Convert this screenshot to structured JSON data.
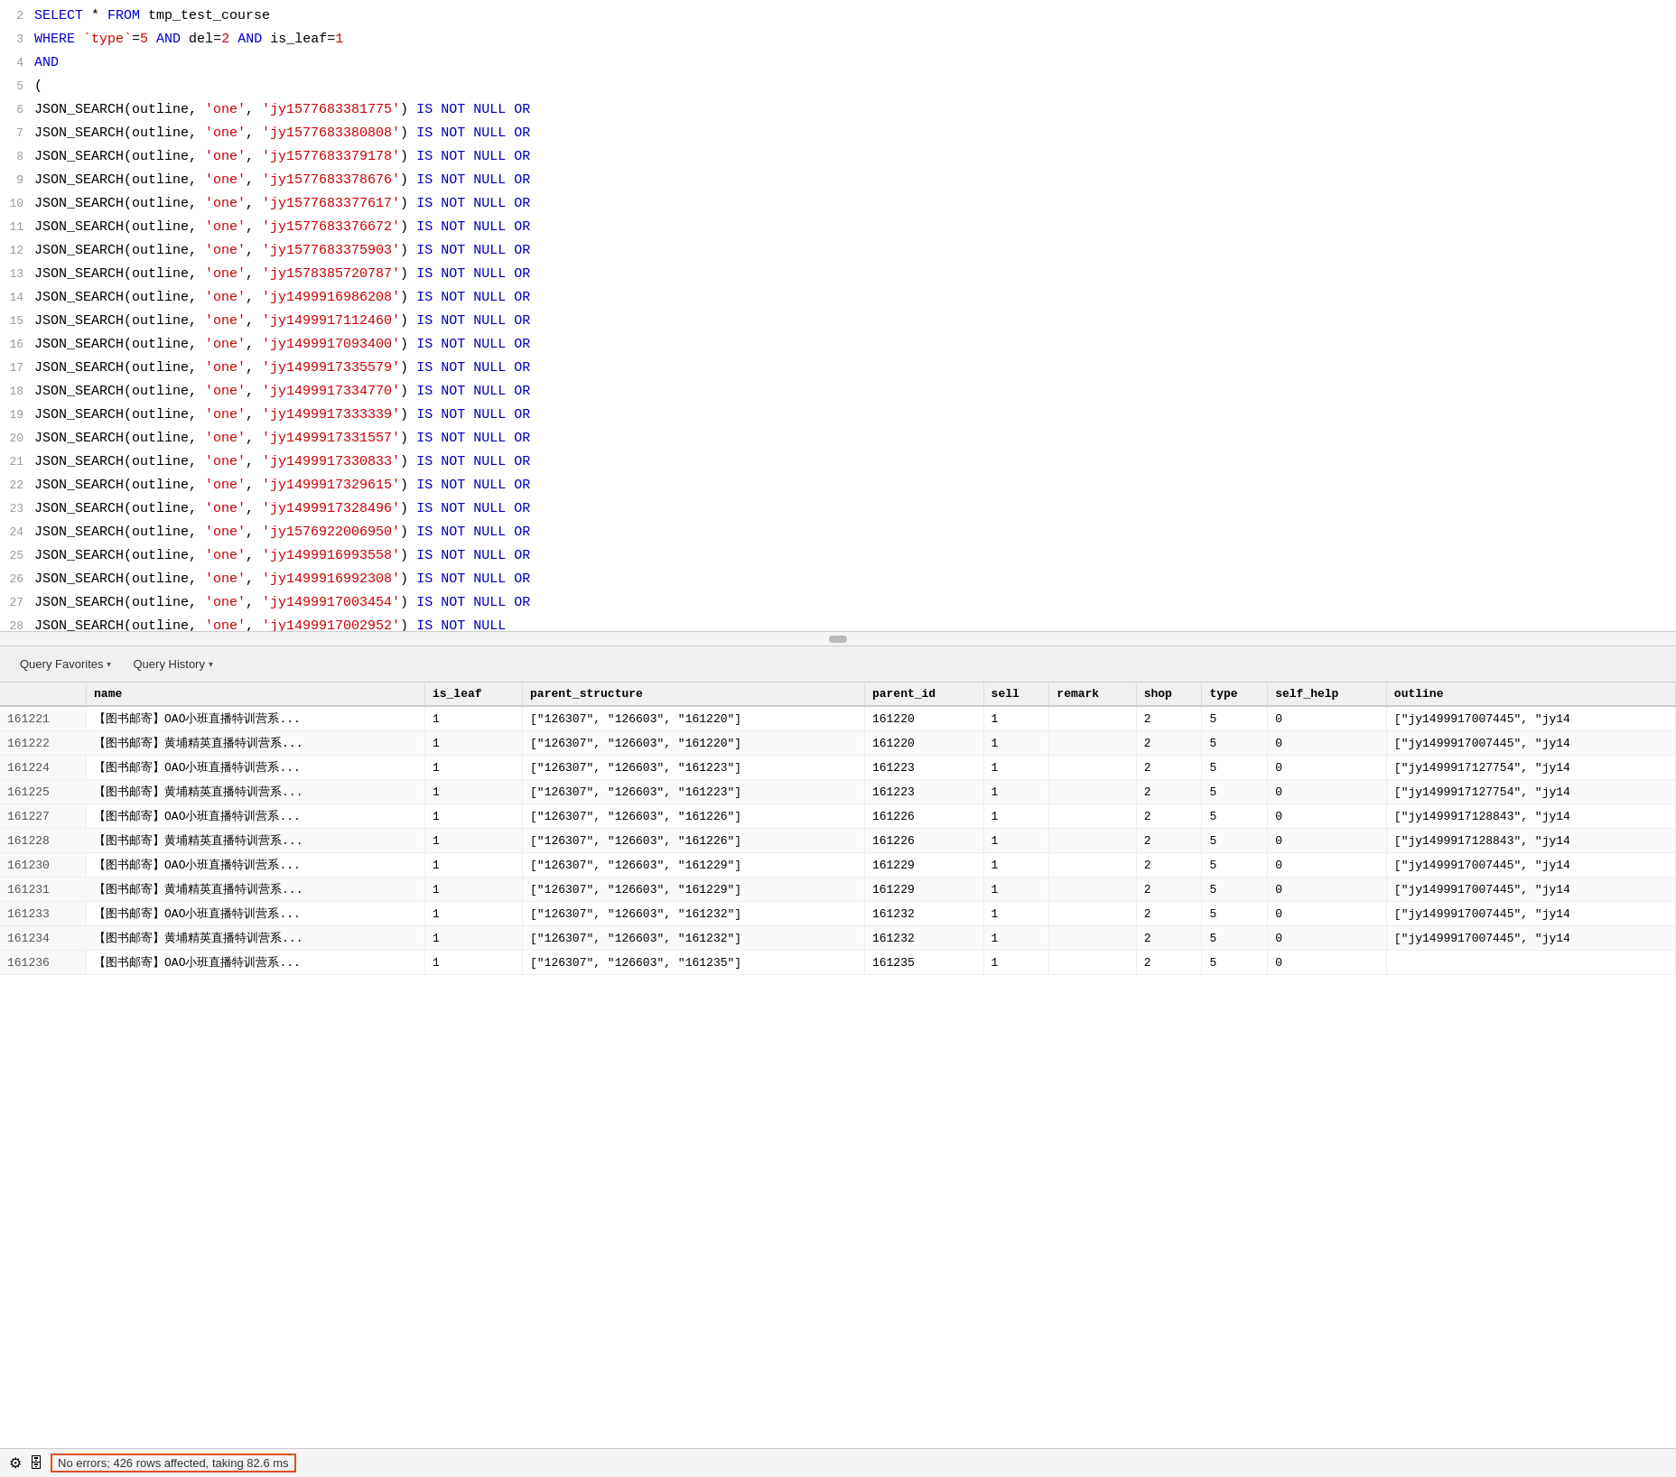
{
  "editor": {
    "lines": [
      {
        "num": "2",
        "tokens": [
          {
            "t": "SELECT * FROM tmp_test_course",
            "c": "kw"
          }
        ]
      },
      {
        "num": "3",
        "tokens": [
          {
            "t": "WHERE ",
            "c": "kw"
          },
          {
            "t": "`type`",
            "c": "tick"
          },
          {
            "t": "=",
            "c": "plain"
          },
          {
            "t": "5",
            "c": "num"
          },
          {
            "t": " AND ",
            "c": "kw"
          },
          {
            "t": "del",
            "c": "plain"
          },
          {
            "t": "=",
            "c": "plain"
          },
          {
            "t": "2",
            "c": "num"
          },
          {
            "t": " AND ",
            "c": "kw"
          },
          {
            "t": "is_leaf",
            "c": "plain"
          },
          {
            "t": "=",
            "c": "plain"
          },
          {
            "t": "1",
            "c": "num"
          }
        ]
      },
      {
        "num": "4",
        "tokens": [
          {
            "t": "AND",
            "c": "kw"
          }
        ]
      },
      {
        "num": "5",
        "tokens": [
          {
            "t": "(",
            "c": "plain"
          }
        ]
      },
      {
        "num": "6",
        "tokens": [
          {
            "t": "JSON_SEARCH",
            "c": "fn"
          },
          {
            "t": "(outline, ",
            "c": "plain"
          },
          {
            "t": "'one'",
            "c": "str"
          },
          {
            "t": ", ",
            "c": "plain"
          },
          {
            "t": "'jy1577683381775'",
            "c": "str"
          },
          {
            "t": ") ",
            "c": "plain"
          },
          {
            "t": "IS NOT NULL OR",
            "c": "op"
          }
        ]
      },
      {
        "num": "7",
        "tokens": [
          {
            "t": "JSON_SEARCH",
            "c": "fn"
          },
          {
            "t": "(outline, ",
            "c": "plain"
          },
          {
            "t": "'one'",
            "c": "str"
          },
          {
            "t": ", ",
            "c": "plain"
          },
          {
            "t": "'jy1577683380808'",
            "c": "str"
          },
          {
            "t": ") ",
            "c": "plain"
          },
          {
            "t": "IS NOT NULL OR",
            "c": "op"
          }
        ]
      },
      {
        "num": "8",
        "tokens": [
          {
            "t": "JSON_SEARCH",
            "c": "fn"
          },
          {
            "t": "(outline, ",
            "c": "plain"
          },
          {
            "t": "'one'",
            "c": "str"
          },
          {
            "t": ", ",
            "c": "plain"
          },
          {
            "t": "'jy1577683379178'",
            "c": "str"
          },
          {
            "t": ") ",
            "c": "plain"
          },
          {
            "t": "IS NOT NULL OR",
            "c": "op"
          }
        ]
      },
      {
        "num": "9",
        "tokens": [
          {
            "t": "JSON_SEARCH",
            "c": "fn"
          },
          {
            "t": "(outline, ",
            "c": "plain"
          },
          {
            "t": "'one'",
            "c": "str"
          },
          {
            "t": ", ",
            "c": "plain"
          },
          {
            "t": "'jy1577683378676'",
            "c": "str"
          },
          {
            "t": ") ",
            "c": "plain"
          },
          {
            "t": "IS NOT NULL OR",
            "c": "op"
          }
        ]
      },
      {
        "num": "10",
        "tokens": [
          {
            "t": "JSON_SEARCH",
            "c": "fn"
          },
          {
            "t": "(outline, ",
            "c": "plain"
          },
          {
            "t": "'one'",
            "c": "str"
          },
          {
            "t": ", ",
            "c": "plain"
          },
          {
            "t": "'jy1577683377617'",
            "c": "str"
          },
          {
            "t": ") ",
            "c": "plain"
          },
          {
            "t": "IS NOT NULL OR",
            "c": "op"
          }
        ]
      },
      {
        "num": "11",
        "tokens": [
          {
            "t": "JSON_SEARCH",
            "c": "fn"
          },
          {
            "t": "(outline, ",
            "c": "plain"
          },
          {
            "t": "'one'",
            "c": "str"
          },
          {
            "t": ", ",
            "c": "plain"
          },
          {
            "t": "'jy1577683376672'",
            "c": "str"
          },
          {
            "t": ") ",
            "c": "plain"
          },
          {
            "t": "IS NOT NULL OR",
            "c": "op"
          }
        ]
      },
      {
        "num": "12",
        "tokens": [
          {
            "t": "JSON_SEARCH",
            "c": "fn"
          },
          {
            "t": "(outline, ",
            "c": "plain"
          },
          {
            "t": "'one'",
            "c": "str"
          },
          {
            "t": ", ",
            "c": "plain"
          },
          {
            "t": "'jy1577683375903'",
            "c": "str"
          },
          {
            "t": ") ",
            "c": "plain"
          },
          {
            "t": "IS NOT NULL OR",
            "c": "op"
          }
        ]
      },
      {
        "num": "13",
        "tokens": [
          {
            "t": "JSON_SEARCH",
            "c": "fn"
          },
          {
            "t": "(outline, ",
            "c": "plain"
          },
          {
            "t": "'one'",
            "c": "str"
          },
          {
            "t": ", ",
            "c": "plain"
          },
          {
            "t": "'jy1578385720787'",
            "c": "str"
          },
          {
            "t": ") ",
            "c": "plain"
          },
          {
            "t": "IS NOT NULL OR",
            "c": "op"
          }
        ]
      },
      {
        "num": "14",
        "tokens": [
          {
            "t": "JSON_SEARCH",
            "c": "fn"
          },
          {
            "t": "(outline, ",
            "c": "plain"
          },
          {
            "t": "'one'",
            "c": "str"
          },
          {
            "t": ", ",
            "c": "plain"
          },
          {
            "t": "'jy1499916986208'",
            "c": "str"
          },
          {
            "t": ") ",
            "c": "plain"
          },
          {
            "t": "IS NOT NULL OR",
            "c": "op"
          }
        ]
      },
      {
        "num": "15",
        "tokens": [
          {
            "t": "JSON_SEARCH",
            "c": "fn"
          },
          {
            "t": "(outline, ",
            "c": "plain"
          },
          {
            "t": "'one'",
            "c": "str"
          },
          {
            "t": ", ",
            "c": "plain"
          },
          {
            "t": "'jy1499917112460'",
            "c": "str"
          },
          {
            "t": ") ",
            "c": "plain"
          },
          {
            "t": "IS NOT NULL OR",
            "c": "op"
          }
        ]
      },
      {
        "num": "16",
        "tokens": [
          {
            "t": "JSON_SEARCH",
            "c": "fn"
          },
          {
            "t": "(outline, ",
            "c": "plain"
          },
          {
            "t": "'one'",
            "c": "str"
          },
          {
            "t": ", ",
            "c": "plain"
          },
          {
            "t": "'jy1499917093400'",
            "c": "str"
          },
          {
            "t": ") ",
            "c": "plain"
          },
          {
            "t": "IS NOT NULL OR",
            "c": "op"
          }
        ]
      },
      {
        "num": "17",
        "tokens": [
          {
            "t": "JSON_SEARCH",
            "c": "fn"
          },
          {
            "t": "(outline, ",
            "c": "plain"
          },
          {
            "t": "'one'",
            "c": "str"
          },
          {
            "t": ", ",
            "c": "plain"
          },
          {
            "t": "'jy1499917335579'",
            "c": "str"
          },
          {
            "t": ") ",
            "c": "plain"
          },
          {
            "t": "IS NOT NULL OR",
            "c": "op"
          }
        ]
      },
      {
        "num": "18",
        "tokens": [
          {
            "t": "JSON_SEARCH",
            "c": "fn"
          },
          {
            "t": "(outline, ",
            "c": "plain"
          },
          {
            "t": "'one'",
            "c": "str"
          },
          {
            "t": ", ",
            "c": "plain"
          },
          {
            "t": "'jy1499917334770'",
            "c": "str"
          },
          {
            "t": ") ",
            "c": "plain"
          },
          {
            "t": "IS NOT NULL OR",
            "c": "op"
          }
        ]
      },
      {
        "num": "19",
        "tokens": [
          {
            "t": "JSON_SEARCH",
            "c": "fn"
          },
          {
            "t": "(outline, ",
            "c": "plain"
          },
          {
            "t": "'one'",
            "c": "str"
          },
          {
            "t": ", ",
            "c": "plain"
          },
          {
            "t": "'jy1499917333339'",
            "c": "str"
          },
          {
            "t": ") ",
            "c": "plain"
          },
          {
            "t": "IS NOT NULL OR",
            "c": "op"
          }
        ]
      },
      {
        "num": "20",
        "tokens": [
          {
            "t": "JSON_SEARCH",
            "c": "fn"
          },
          {
            "t": "(outline, ",
            "c": "plain"
          },
          {
            "t": "'one'",
            "c": "str"
          },
          {
            "t": ", ",
            "c": "plain"
          },
          {
            "t": "'jy1499917331557'",
            "c": "str"
          },
          {
            "t": ") ",
            "c": "plain"
          },
          {
            "t": "IS NOT NULL OR",
            "c": "op"
          }
        ]
      },
      {
        "num": "21",
        "tokens": [
          {
            "t": "JSON_SEARCH",
            "c": "fn"
          },
          {
            "t": "(outline, ",
            "c": "plain"
          },
          {
            "t": "'one'",
            "c": "str"
          },
          {
            "t": ", ",
            "c": "plain"
          },
          {
            "t": "'jy1499917330833'",
            "c": "str"
          },
          {
            "t": ") ",
            "c": "plain"
          },
          {
            "t": "IS NOT NULL OR",
            "c": "op"
          }
        ]
      },
      {
        "num": "22",
        "tokens": [
          {
            "t": "JSON_SEARCH",
            "c": "fn"
          },
          {
            "t": "(outline, ",
            "c": "plain"
          },
          {
            "t": "'one'",
            "c": "str"
          },
          {
            "t": ", ",
            "c": "plain"
          },
          {
            "t": "'jy1499917329615'",
            "c": "str"
          },
          {
            "t": ") ",
            "c": "plain"
          },
          {
            "t": "IS NOT NULL OR",
            "c": "op"
          }
        ]
      },
      {
        "num": "23",
        "tokens": [
          {
            "t": "JSON_SEARCH",
            "c": "fn"
          },
          {
            "t": "(outline, ",
            "c": "plain"
          },
          {
            "t": "'one'",
            "c": "str"
          },
          {
            "t": ", ",
            "c": "plain"
          },
          {
            "t": "'jy1499917328496'",
            "c": "str"
          },
          {
            "t": ") ",
            "c": "plain"
          },
          {
            "t": "IS NOT NULL OR",
            "c": "op"
          }
        ]
      },
      {
        "num": "24",
        "tokens": [
          {
            "t": "JSON_SEARCH",
            "c": "fn"
          },
          {
            "t": "(outline, ",
            "c": "plain"
          },
          {
            "t": "'one'",
            "c": "str"
          },
          {
            "t": ", ",
            "c": "plain"
          },
          {
            "t": "'jy1576922006950'",
            "c": "str"
          },
          {
            "t": ") ",
            "c": "plain"
          },
          {
            "t": "IS NOT NULL OR",
            "c": "op"
          }
        ]
      },
      {
        "num": "25",
        "tokens": [
          {
            "t": "JSON_SEARCH",
            "c": "fn"
          },
          {
            "t": "(outline, ",
            "c": "plain"
          },
          {
            "t": "'one'",
            "c": "str"
          },
          {
            "t": ", ",
            "c": "plain"
          },
          {
            "t": "'jy1499916993558'",
            "c": "str"
          },
          {
            "t": ") ",
            "c": "plain"
          },
          {
            "t": "IS NOT NULL OR",
            "c": "op"
          }
        ]
      },
      {
        "num": "26",
        "tokens": [
          {
            "t": "JSON_SEARCH",
            "c": "fn"
          },
          {
            "t": "(outline, ",
            "c": "plain"
          },
          {
            "t": "'one'",
            "c": "str"
          },
          {
            "t": ", ",
            "c": "plain"
          },
          {
            "t": "'jy1499916992308'",
            "c": "str"
          },
          {
            "t": ") ",
            "c": "plain"
          },
          {
            "t": "IS NOT NULL OR",
            "c": "op"
          }
        ]
      },
      {
        "num": "27",
        "tokens": [
          {
            "t": "JSON_SEARCH",
            "c": "fn"
          },
          {
            "t": "(outline, ",
            "c": "plain"
          },
          {
            "t": "'one'",
            "c": "str"
          },
          {
            "t": ", ",
            "c": "plain"
          },
          {
            "t": "'jy1499917003454'",
            "c": "str"
          },
          {
            "t": ") ",
            "c": "plain"
          },
          {
            "t": "IS NOT NULL OR",
            "c": "op"
          }
        ]
      },
      {
        "num": "28",
        "tokens": [
          {
            "t": "JSON_SEARCH",
            "c": "fn"
          },
          {
            "t": "(outline, ",
            "c": "plain"
          },
          {
            "t": "'one'",
            "c": "str"
          },
          {
            "t": ", ",
            "c": "plain"
          },
          {
            "t": "'jy1499917002952'",
            "c": "str"
          },
          {
            "t": ") ",
            "c": "plain"
          },
          {
            "t": "IS NOT NULL",
            "c": "op"
          }
        ]
      },
      {
        "num": "29",
        "tokens": [
          {
            "t": ")",
            "c": "plain"
          }
        ]
      }
    ]
  },
  "toolbar": {
    "query_favorites_label": "Query Favorites",
    "query_history_label": "Query History",
    "chevron": "▾"
  },
  "table": {
    "columns": [
      "",
      "name",
      "is_leaf",
      "parent_structure",
      "parent_id",
      "sell",
      "remark",
      "shop",
      "type",
      "self_help",
      "outline"
    ],
    "rows": [
      [
        "161221",
        "【图书邮寄】OAO小班直播特训营系...",
        "1",
        "[\"126307\", \"126603\", \"161220\"]",
        "161220",
        "1",
        "",
        "2",
        "5",
        "0",
        "[\"jy1499917007445\", \"jy14"
      ],
      [
        "161222",
        "【图书邮寄】黄埔精英直播特训营系...",
        "1",
        "[\"126307\", \"126603\", \"161220\"]",
        "161220",
        "1",
        "",
        "2",
        "5",
        "0",
        "[\"jy1499917007445\", \"jy14"
      ],
      [
        "161224",
        "【图书邮寄】OAO小班直播特训营系...",
        "1",
        "[\"126307\", \"126603\", \"161223\"]",
        "161223",
        "1",
        "",
        "2",
        "5",
        "0",
        "[\"jy1499917127754\", \"jy14"
      ],
      [
        "161225",
        "【图书邮寄】黄埔精英直播特训营系...",
        "1",
        "[\"126307\", \"126603\", \"161223\"]",
        "161223",
        "1",
        "",
        "2",
        "5",
        "0",
        "[\"jy1499917127754\", \"jy14"
      ],
      [
        "161227",
        "【图书邮寄】OAO小班直播特训营系...",
        "1",
        "[\"126307\", \"126603\", \"161226\"]",
        "161226",
        "1",
        "",
        "2",
        "5",
        "0",
        "[\"jy1499917128843\", \"jy14"
      ],
      [
        "161228",
        "【图书邮寄】黄埔精英直播特训营系...",
        "1",
        "[\"126307\", \"126603\", \"161226\"]",
        "161226",
        "1",
        "",
        "2",
        "5",
        "0",
        "[\"jy1499917128843\", \"jy14"
      ],
      [
        "161230",
        "【图书邮寄】OAO小班直播特训营系...",
        "1",
        "[\"126307\", \"126603\", \"161229\"]",
        "161229",
        "1",
        "",
        "2",
        "5",
        "0",
        "[\"jy1499917007445\", \"jy14"
      ],
      [
        "161231",
        "【图书邮寄】黄埔精英直播特训营系...",
        "1",
        "[\"126307\", \"126603\", \"161229\"]",
        "161229",
        "1",
        "",
        "2",
        "5",
        "0",
        "[\"jy1499917007445\", \"jy14"
      ],
      [
        "161233",
        "【图书邮寄】OAO小班直播特训营系...",
        "1",
        "[\"126307\", \"126603\", \"161232\"]",
        "161232",
        "1",
        "",
        "2",
        "5",
        "0",
        "[\"jy1499917007445\", \"jy14"
      ],
      [
        "161234",
        "【图书邮寄】黄埔精英直播特训营系...",
        "1",
        "[\"126307\", \"126603\", \"161232\"]",
        "161232",
        "1",
        "",
        "2",
        "5",
        "0",
        "[\"jy1499917007445\", \"jy14"
      ],
      [
        "161236",
        "【图书邮寄】OAO小班直播特训营系...",
        "1",
        "[\"126307\", \"126603\", \"161235\"]",
        "161235",
        "1",
        "",
        "2",
        "5",
        "0",
        ""
      ]
    ]
  },
  "status": {
    "gear_icon": "⚙",
    "db_icon": "🗄",
    "message": "No errors; 426 rows affected, taking 82.6 ms"
  }
}
